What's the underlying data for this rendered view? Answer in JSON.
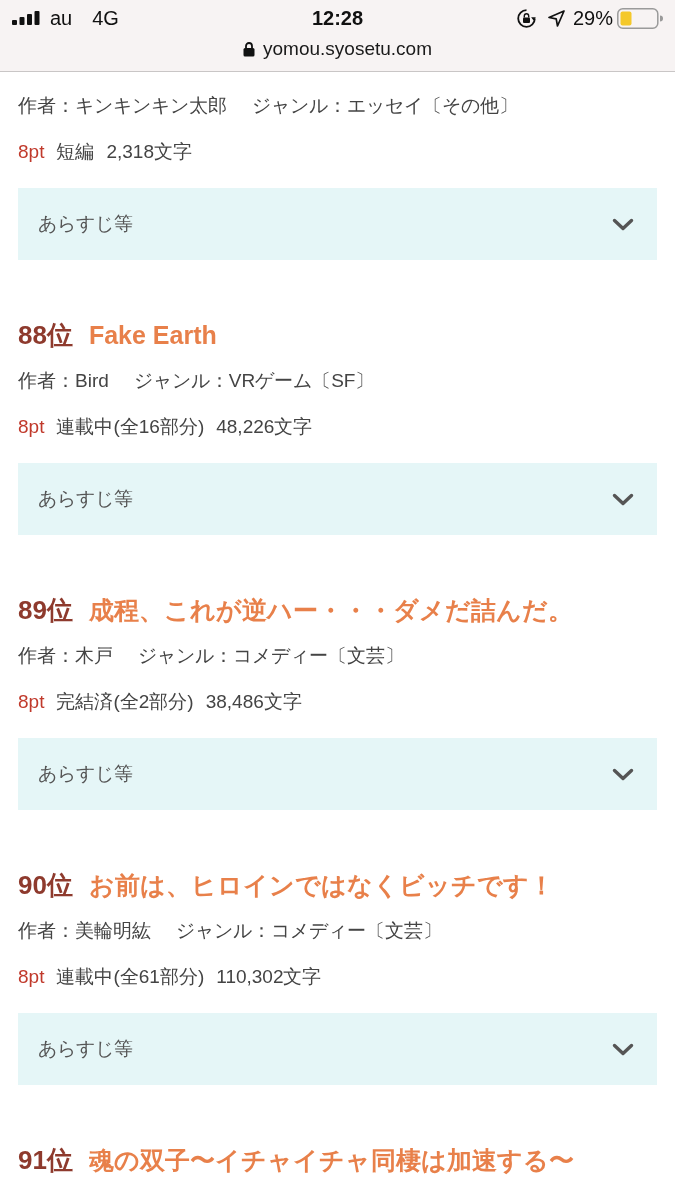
{
  "status_bar": {
    "carrier": "au",
    "network": "4G",
    "time": "12:28",
    "battery_percent": "29%"
  },
  "address_bar": {
    "url": "yomou.syosetu.com"
  },
  "rankings": [
    {
      "author": "作者：キンキンキン太郎",
      "genre": "ジャンル：エッセイ〔その他〕",
      "points": "8pt",
      "status": "短編",
      "length": "2,318文字",
      "synopsis": {
        "label": "あらすじ等",
        "expanded": false
      }
    },
    {
      "rank": "88位",
      "title": "Fake Earth",
      "author": "作者：Bird",
      "genre": "ジャンル：VRゲーム〔SF〕",
      "points": "8pt",
      "status": "連載中(全16部分)",
      "length": "48,226文字",
      "synopsis": {
        "label": "あらすじ等",
        "expanded": false
      }
    },
    {
      "rank": "89位",
      "title": "成程、これが逆ハー・・・ダメだ詰んだ。",
      "author": "作者：木戸",
      "genre": "ジャンル：コメディー〔文芸〕",
      "points": "8pt",
      "status": "完結済(全2部分)",
      "length": "38,486文字",
      "synopsis": {
        "label": "あらすじ等",
        "expanded": false
      }
    },
    {
      "rank": "90位",
      "title": "お前は、ヒロインではなくビッチです！",
      "author": "作者：美輪明紘",
      "genre": "ジャンル：コメディー〔文芸〕",
      "points": "8pt",
      "status": "連載中(全61部分)",
      "length": "110,302文字",
      "synopsis": {
        "label": "あらすじ等",
        "expanded": false
      }
    },
    {
      "rank": "91位",
      "title": "魂の双子〜イチャイチャ同棲は加速する〜"
    }
  ]
}
